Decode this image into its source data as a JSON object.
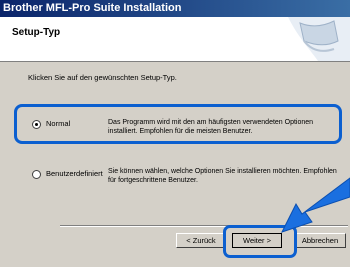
{
  "window": {
    "title": "Brother MFL-Pro Suite Installation"
  },
  "header": {
    "title": "Setup-Typ"
  },
  "instruction": "Klicken Sie auf den gewünschten Setup-Typ.",
  "options": [
    {
      "label": "Normal",
      "selected": true,
      "description": "Das Programm wird mit den am häufigsten verwendeten Optionen installiert. Empfohlen für die meisten Benutzer."
    },
    {
      "label": "Benutzerdefiniert",
      "selected": false,
      "description": "Sie können wählen, welche Optionen Sie installieren möchten. Empfohlen für fortgeschrittene Benutzer."
    }
  ],
  "buttons": {
    "back": "< Zurück",
    "next": "Weiter >",
    "cancel": "Abbrechen"
  },
  "colors": {
    "highlight": "#0b5fd0",
    "titlebar": "#0a246a",
    "dialog": "#d4d0c8"
  },
  "icons": {
    "header_graphic": "setup-logo-icon",
    "pointer": "pointer-arrow-icon"
  }
}
